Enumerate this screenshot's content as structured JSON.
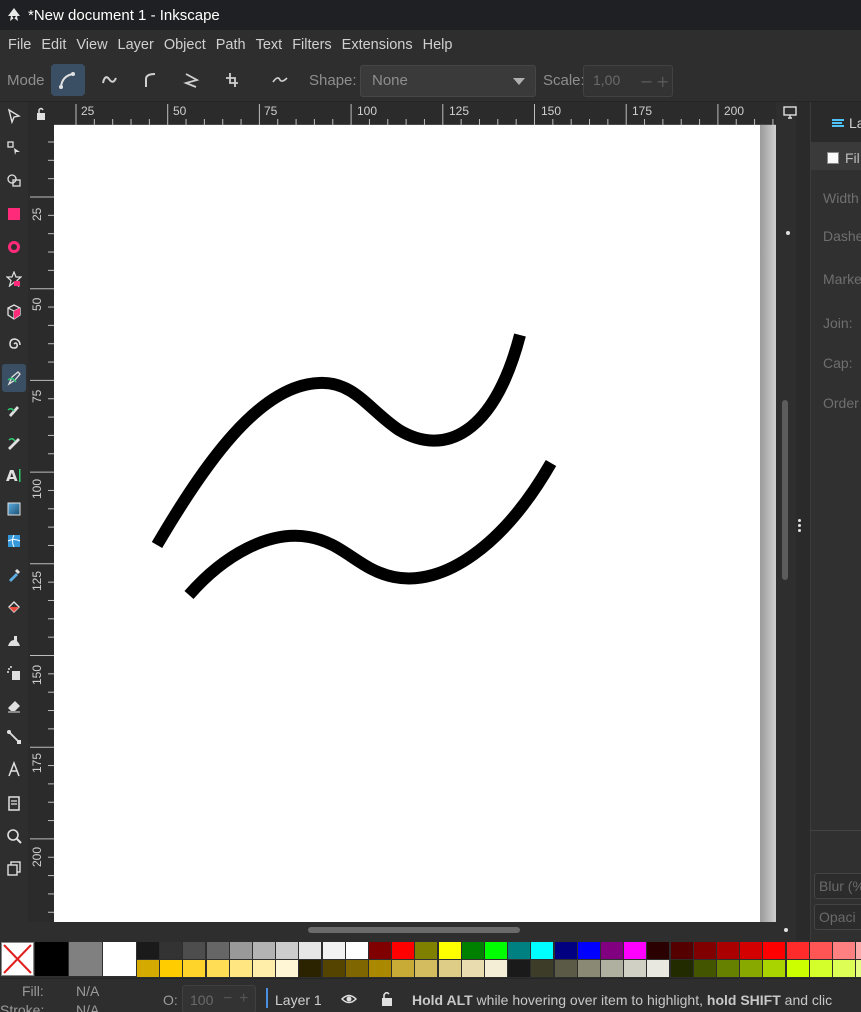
{
  "window": {
    "title": "*New document 1 - Inkscape"
  },
  "menu": [
    "File",
    "Edit",
    "View",
    "Layer",
    "Object",
    "Path",
    "Text",
    "Filters",
    "Extensions",
    "Help"
  ],
  "tool_controls": {
    "mode_label": "Mode",
    "shape_label": "Shape:",
    "shape_value": "None",
    "scale_label": "Scale:",
    "scale_value": "1,00",
    "minus": "−",
    "plus": "+"
  },
  "rulers": {
    "horizontal": [
      "25",
      "50",
      "75",
      "100",
      "125",
      "150",
      "175",
      "200"
    ],
    "vertical": [
      "25",
      "50",
      "75",
      "100",
      "125",
      "150",
      "175",
      "200"
    ]
  },
  "right_panel": {
    "tab_label": "La",
    "fill_checkbox_label": "Fil",
    "fields": [
      "Width",
      "Dashe",
      "Marke",
      "Join:",
      "Cap:",
      "Order"
    ],
    "blur_label": "Blur (%",
    "opacity_label": "Opaci"
  },
  "status": {
    "fill_label": "Fill:",
    "fill_value": "N/A",
    "stroke_label": "Stroke:",
    "stroke_value": "N/A",
    "opacity_label": "O:",
    "opacity_value": "100",
    "layer_name": "Layer 1",
    "msg_b1": "Hold ALT",
    "msg_t1": " while hovering over item to highlight, ",
    "msg_b2": "hold SHIFT",
    "msg_t2": " and clic"
  },
  "colors": {
    "accent": "#3b4f64",
    "stroke": "#000000",
    "canvas": "#ffffff"
  },
  "palette_row1": [
    "#1a1a1a",
    "#333333",
    "#4d4d4d",
    "#666666",
    "#999999",
    "#b3b3b3",
    "#cccccc",
    "#e6e6e6",
    "#f2f2f2",
    "#ffffff",
    "#800000",
    "#ff0000",
    "#808000",
    "#ffff00",
    "#008000",
    "#00ff00",
    "#008080",
    "#00ffff",
    "#000080",
    "#0000ff",
    "#800080",
    "#ff00ff",
    "#2b0000",
    "#550000",
    "#800000",
    "#aa0000",
    "#d40000",
    "#ff0000",
    "#ff2a2a",
    "#ff5555",
    "#ff8080",
    "#ffaaaa"
  ],
  "palette_row2": [
    "#d4aa00",
    "#ffcc00",
    "#ffd42a",
    "#ffdd55",
    "#ffe680",
    "#ffeeaa",
    "#fff6d5",
    "#2b2200",
    "#554400",
    "#806600",
    "#aa8800",
    "#c8ab37",
    "#d3bc5f",
    "#decd87",
    "#e9ddaf",
    "#f4eed7",
    "#1a1a1a",
    "#3c3c28",
    "#5a5a46",
    "#8a8a74",
    "#b0b0a0",
    "#d0d0c4",
    "#e8e8e0",
    "#222b00",
    "#445500",
    "#668000",
    "#88aa00",
    "#aad400",
    "#ccff00",
    "#d4ff2a",
    "#ddff55",
    "#e5ff80"
  ]
}
